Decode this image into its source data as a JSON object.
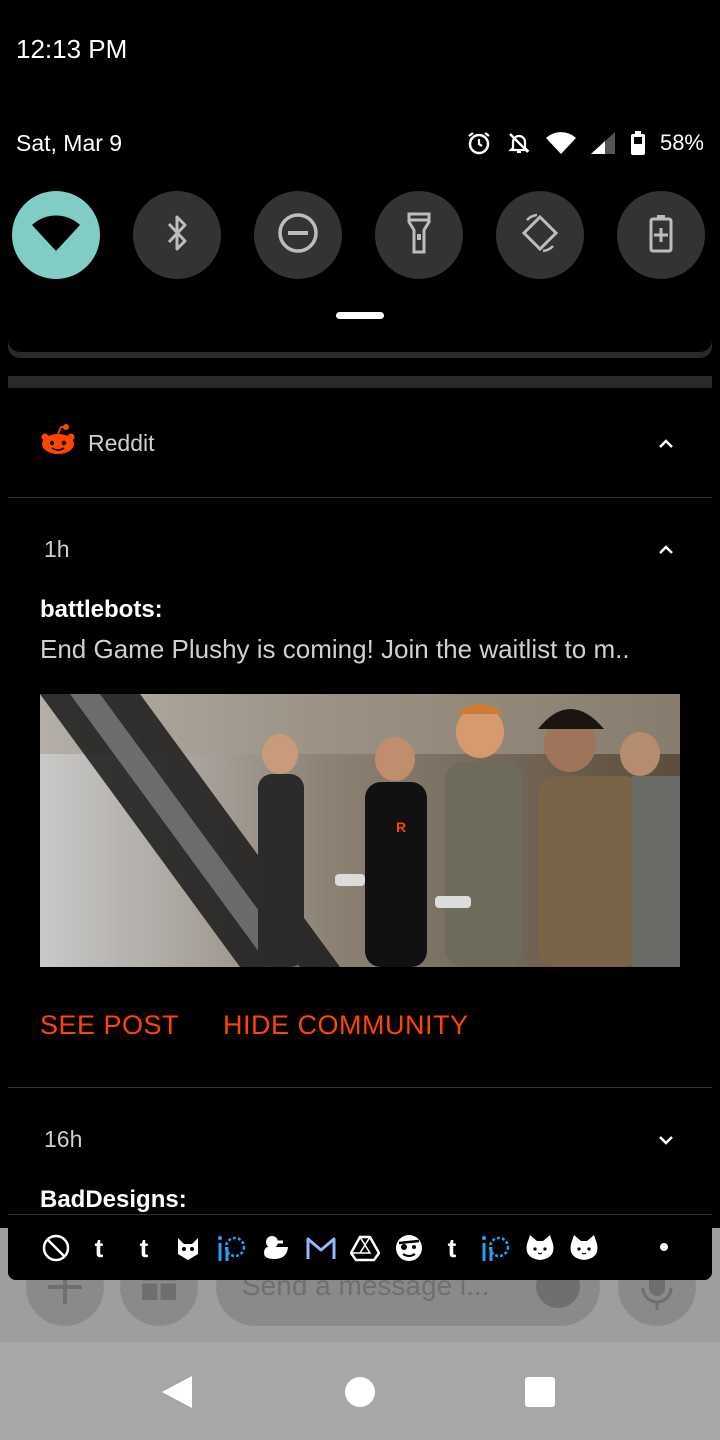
{
  "status_bar": {
    "time": "12:13 PM"
  },
  "quick_settings": {
    "date": "Sat, Mar 9",
    "battery_percent": "58%",
    "tiles": [
      {
        "name": "wifi",
        "active": true
      },
      {
        "name": "bluetooth",
        "active": false
      },
      {
        "name": "do-not-disturb",
        "active": false
      },
      {
        "name": "flashlight",
        "active": false
      },
      {
        "name": "auto-rotate",
        "active": false
      },
      {
        "name": "battery-saver",
        "active": false
      }
    ],
    "colors": {
      "active_tile": "#7fcdc4",
      "inactive_tile": "#333333"
    }
  },
  "notification": {
    "app_name": "Reddit",
    "brand_color": "#ff4500",
    "items": [
      {
        "time": "1h",
        "title": "battlebots:",
        "body": "End Game Plushy is coming! Join the waitlist to m..",
        "actions": [
          "SEE POST",
          "HIDE COMMUNITY"
        ],
        "expanded": true
      },
      {
        "time": "16h",
        "title": "BadDesigns:",
        "expanded": false
      }
    ],
    "tray_icons": [
      "blocked-icon",
      "tumblr-icon",
      "tumblr-icon",
      "cat-face-icon",
      "ifttt-icon",
      "duck-icon",
      "gmail-icon",
      "drive-icon",
      "pirate-face-icon",
      "tumblr-icon",
      "ifttt-icon",
      "cat-icon",
      "cat-icon"
    ],
    "tray_text_glyph": "t"
  },
  "background_app": {
    "message_placeholder": "Send a message i..."
  }
}
